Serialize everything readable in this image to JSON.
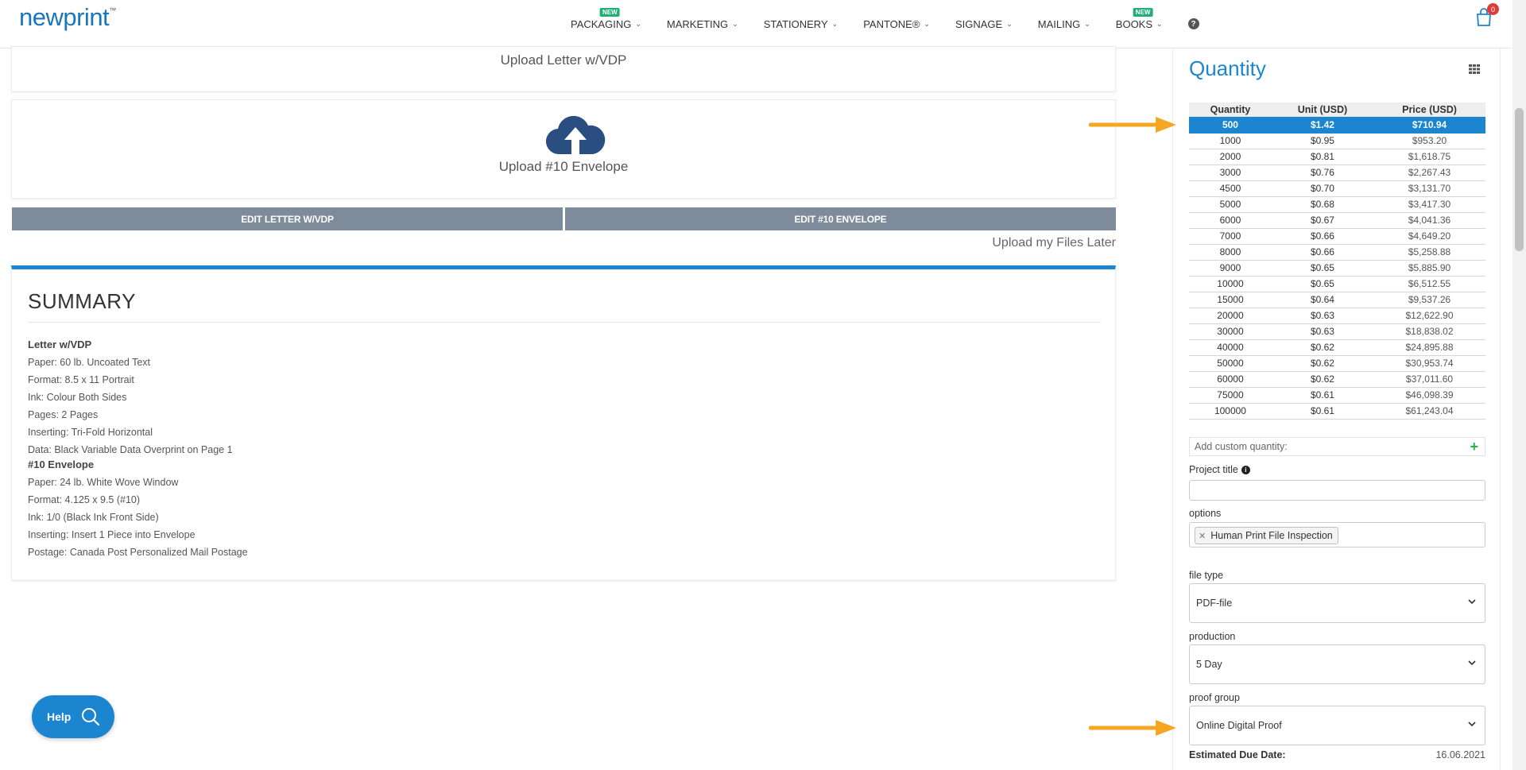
{
  "header": {
    "logo": "newprint",
    "logo_tm": "™",
    "nav": [
      {
        "label": "PACKAGING",
        "badge": "NEW"
      },
      {
        "label": "MARKETING",
        "badge": ""
      },
      {
        "label": "STATIONERY",
        "badge": ""
      },
      {
        "label": "PANTONE®",
        "badge": ""
      },
      {
        "label": "SIGNAGE",
        "badge": ""
      },
      {
        "label": "MAILING",
        "badge": ""
      },
      {
        "label": "BOOKS",
        "badge": "NEW"
      }
    ],
    "help_glyph": "?",
    "cart_count": "0"
  },
  "uploads": {
    "letter_label": "Upload Letter w/VDP",
    "envelope_label": "Upload #10 Envelope",
    "edit_letter": "EDIT LETTER W/VDP",
    "edit_envelope": "EDIT #10 ENVELOPE",
    "upload_later": "Upload my Files Later"
  },
  "summary": {
    "title": "SUMMARY",
    "sections": [
      {
        "title": "Letter w/VDP",
        "lines": [
          "Paper: 60 lb. Uncoated Text",
          "Format: 8.5 x 11 Portrait",
          "Ink: Colour Both Sides",
          "Pages: 2 Pages",
          "Inserting: Tri-Fold Horizontal",
          "Data: Black Variable Data Overprint on Page 1"
        ]
      },
      {
        "title": "#10 Envelope",
        "lines": [
          "Paper: 24 lb. White Wove Window",
          "Format: 4.125 x 9.5 (#10)",
          "Ink: 1/0 (Black Ink Front Side)",
          "Inserting: Insert 1 Piece into Envelope",
          "Postage: Canada Post Personalized Mail Postage"
        ]
      }
    ]
  },
  "help_button": "Help",
  "quantity_panel": {
    "title": "Quantity",
    "columns": [
      "Quantity",
      "Unit (USD)",
      "Price (USD)"
    ],
    "selected_index": 0,
    "rows": [
      [
        "500",
        "$1.42",
        "$710.94"
      ],
      [
        "1000",
        "$0.95",
        "$953.20"
      ],
      [
        "2000",
        "$0.81",
        "$1,618.75"
      ],
      [
        "3000",
        "$0.76",
        "$2,267.43"
      ],
      [
        "4500",
        "$0.70",
        "$3,131.70"
      ],
      [
        "5000",
        "$0.68",
        "$3,417.30"
      ],
      [
        "6000",
        "$0.67",
        "$4,041.36"
      ],
      [
        "7000",
        "$0.66",
        "$4,649.20"
      ],
      [
        "8000",
        "$0.66",
        "$5,258.88"
      ],
      [
        "9000",
        "$0.65",
        "$5,885.90"
      ],
      [
        "10000",
        "$0.65",
        "$6,512.55"
      ],
      [
        "15000",
        "$0.64",
        "$9,537.26"
      ],
      [
        "20000",
        "$0.63",
        "$12,622.90"
      ],
      [
        "30000",
        "$0.63",
        "$18,838.02"
      ],
      [
        "40000",
        "$0.62",
        "$24,895.88"
      ],
      [
        "50000",
        "$0.62",
        "$30,953.74"
      ],
      [
        "60000",
        "$0.62",
        "$37,011.60"
      ],
      [
        "75000",
        "$0.61",
        "$46,098.39"
      ],
      [
        "100000",
        "$0.61",
        "$61,243.04"
      ]
    ],
    "custom_qty_placeholder": "Add custom quantity:",
    "project_title_label": "Project title",
    "project_title_value": "",
    "options_label": "options",
    "options_tags": [
      "Human Print File Inspection"
    ],
    "file_type_label": "file type",
    "file_type_value": "PDF-file",
    "production_label": "production",
    "production_value": "5 Day",
    "proof_group_label": "proof group",
    "proof_group_value": "Online Digital Proof",
    "due_date_label": "Estimated Due Date:",
    "due_date_value": "16.06.2021"
  },
  "colors": {
    "brand_blue": "#1b85d0",
    "edit_button": "#7e8b9a",
    "annotation_arrow": "#f5a623",
    "new_badge": "#1fae73"
  }
}
